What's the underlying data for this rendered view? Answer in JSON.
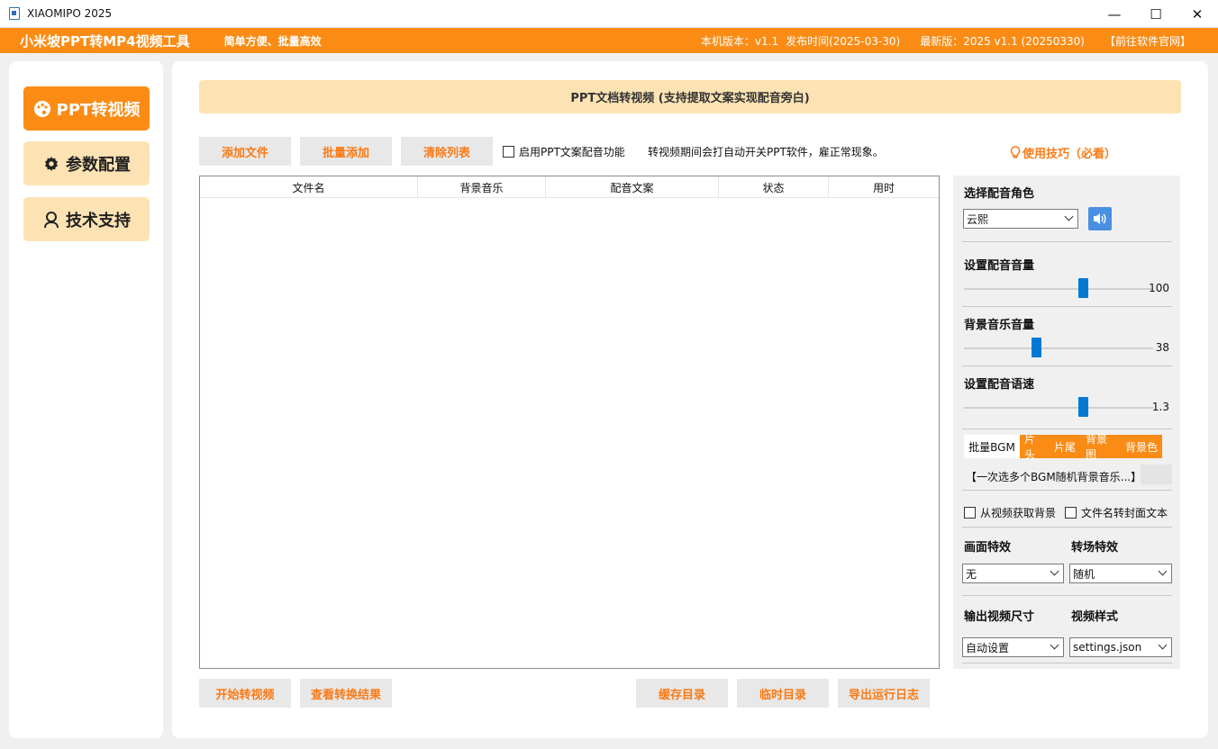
{
  "window": {
    "title": "XIAOMIPO 2025",
    "controls": {
      "minimize": "—",
      "maximize": "☐",
      "close": "✕"
    }
  },
  "header": {
    "brand": "小米坡PPT转MP4视频工具",
    "tagline": "简单方便、批量高效",
    "local_version": "本机版本：v1.1",
    "release_date": "发布时间(2025-03-30)",
    "latest_version": "最新版：2025 v1.1 (20250330)",
    "website_link": "【前往软件官网】"
  },
  "sidebar": {
    "items": [
      {
        "label": "PPT转视频",
        "icon": "palette-icon",
        "active": true
      },
      {
        "label": "参数配置",
        "icon": "gear-icon",
        "active": false
      },
      {
        "label": "技术支持",
        "icon": "support-icon",
        "active": false
      }
    ]
  },
  "main": {
    "banner": "PPT文档转视频 (支持提取文案实现配音旁白)",
    "toolbar": {
      "add_file": "添加文件",
      "batch_add": "批量添加",
      "clear_list": "清除列表",
      "enable_voice": "启用PPT文案配音功能",
      "notice": "转视频期间会打自动开关PPT软件，雇正常现象。",
      "tips": "使用技巧（必看）"
    },
    "table": {
      "columns": [
        "文件名",
        "背景音乐",
        "配音文案",
        "状态",
        "用时"
      ]
    },
    "bottom": {
      "start": "开始转视频",
      "view_results": "查看转换结果",
      "cache_dir": "缓存目录",
      "temp_dir": "临时目录",
      "export_log": "导出运行日志"
    }
  },
  "settings": {
    "voice_role_label": "选择配音角色",
    "voice_role_value": "云熙",
    "voice_volume_label": "设置配音音量",
    "voice_volume_value": "100",
    "voice_volume_fraction": 0.63,
    "bgm_volume_label": "背景音乐音量",
    "bgm_volume_value": "38",
    "bgm_volume_fraction": 0.38,
    "voice_speed_label": "设置配音语速",
    "voice_speed_value": "1.3",
    "voice_speed_fraction": 0.63,
    "tabs": [
      "批量BGM",
      "片头",
      "片尾",
      "背景图",
      "背景色"
    ],
    "bgm_hint": "【一次选多个BGM随机背景音乐...】",
    "from_video_bg": "从视频获取背景",
    "filename_cover": "文件名转封面文本",
    "effect_label": "画面特效",
    "effect_value": "无",
    "transition_label": "转场特效",
    "transition_value": "随机",
    "output_size_label": "输出视频尺寸",
    "output_size_value": "自动设置",
    "video_style_label": "视频样式",
    "video_style_value": "settings.json"
  },
  "colors": {
    "accent": "#fa8c16",
    "accent_light": "#fde3b3",
    "slider": "#0078d4"
  }
}
